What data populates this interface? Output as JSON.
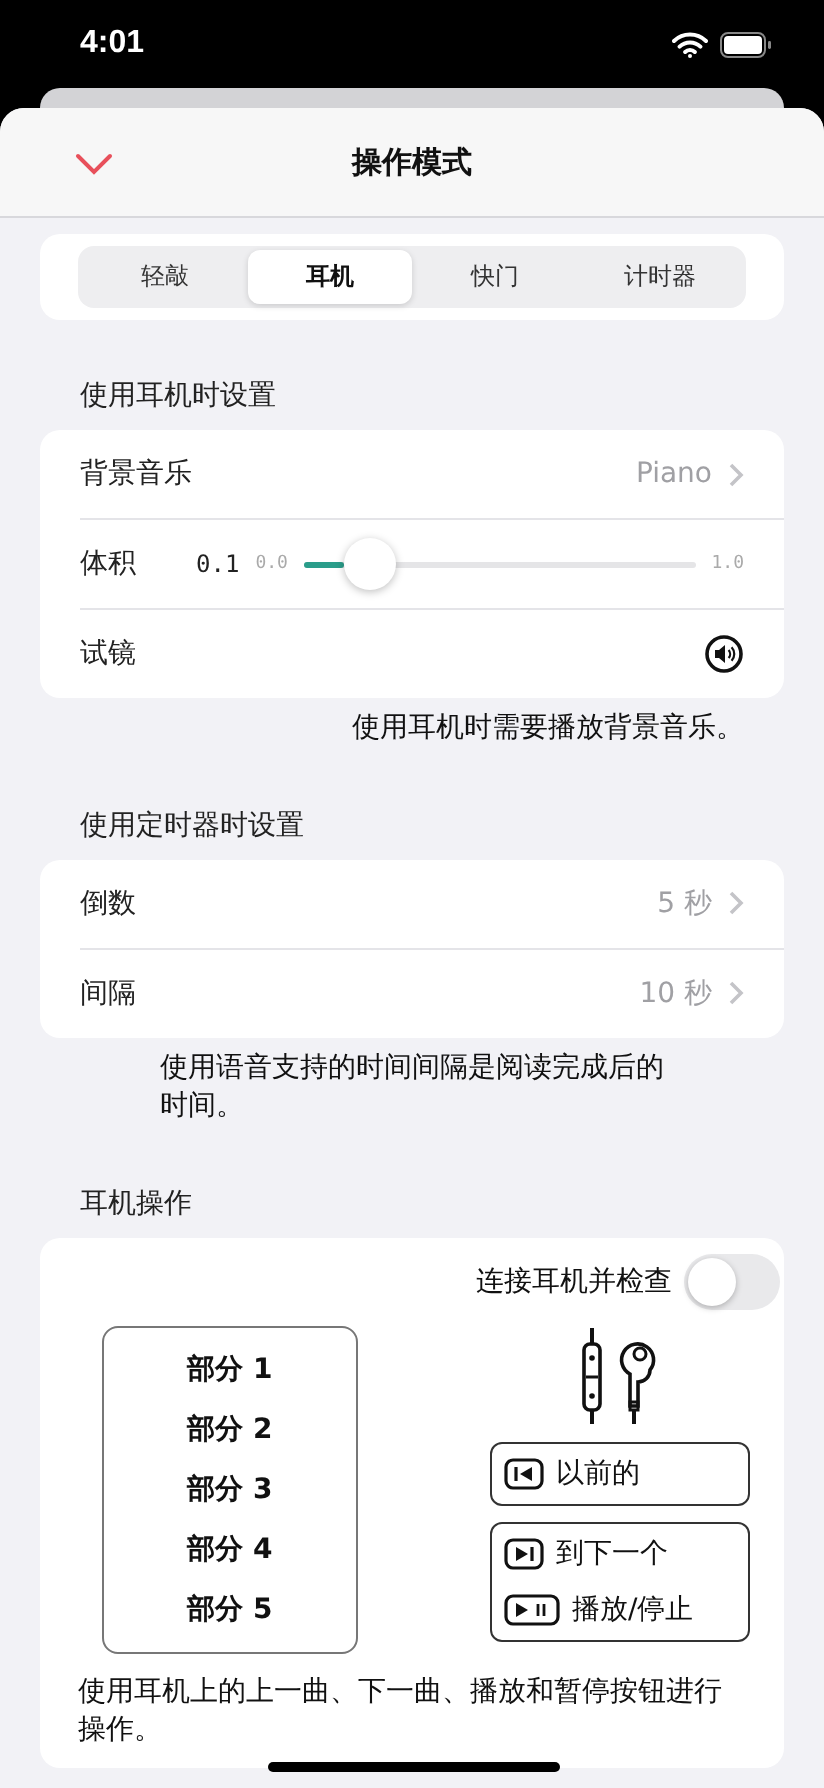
{
  "status_bar": {
    "time": "4:01"
  },
  "header": {
    "title": "操作模式"
  },
  "tabs": [
    {
      "label": "轻敲",
      "selected": false
    },
    {
      "label": "耳机",
      "selected": true
    },
    {
      "label": "快门",
      "selected": false
    },
    {
      "label": "计时器",
      "selected": false
    }
  ],
  "headphone_settings": {
    "heading": "使用耳机时设置",
    "background_music": {
      "label": "背景音乐",
      "value": "Piano"
    },
    "volume": {
      "label": "体积",
      "reading": "0.1",
      "min": "0.0",
      "max": "1.0",
      "level": 0.1
    },
    "preview": {
      "label": "试镜"
    },
    "footer": "使用耳机时需要播放背景音乐。"
  },
  "timer_settings": {
    "heading": "使用定时器时设置",
    "rows": [
      {
        "label": "倒数",
        "value": "5 秒"
      },
      {
        "label": "间隔",
        "value": "10 秒"
      }
    ],
    "footer": "使用语音支持的时间间隔是阅读完成后的时间。"
  },
  "headphone_operation": {
    "heading": "耳机操作",
    "toggle": {
      "label": "连接耳机并检查",
      "on": false
    },
    "parts": [
      "部分 1",
      "部分 2",
      "部分 3",
      "部分 4",
      "部分 5"
    ],
    "button_groups": [
      [
        {
          "kind": "previous",
          "label": "以前的"
        }
      ],
      [
        {
          "kind": "next",
          "label": "到下一个"
        },
        {
          "kind": "playpause",
          "label": "播放/停止"
        }
      ]
    ],
    "footer": "使用耳机上的上一曲、下一曲、播放和暂停按钮进行操作。"
  }
}
